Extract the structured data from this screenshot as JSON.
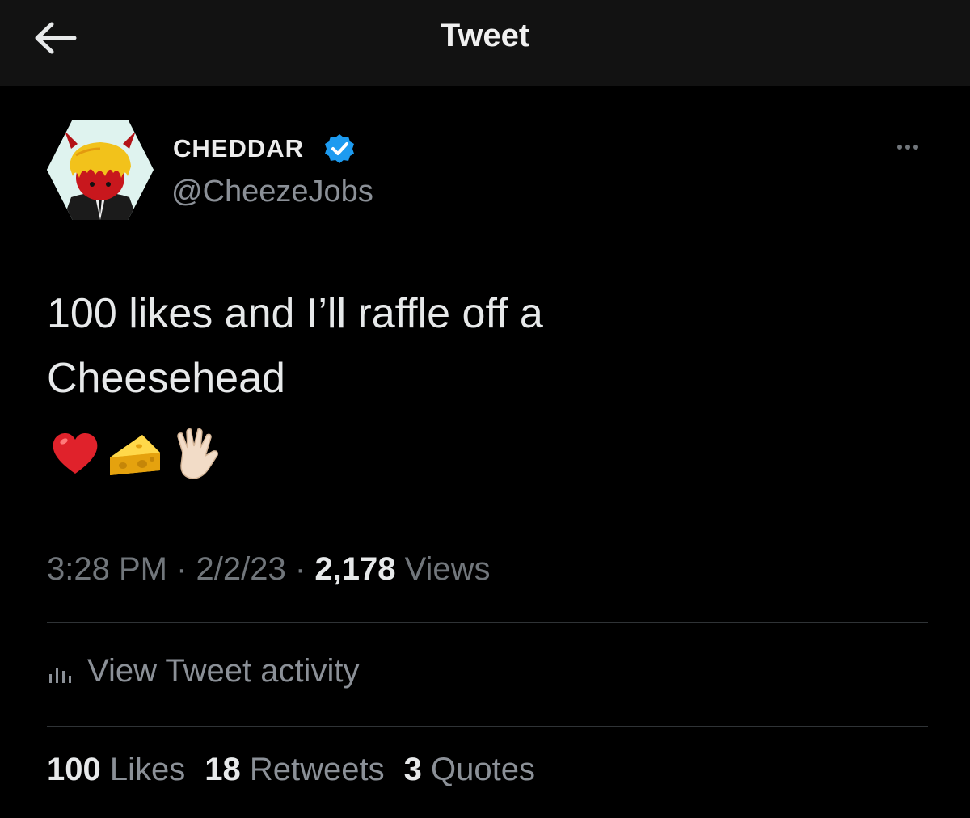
{
  "header": {
    "title": "Tweet",
    "back_icon": "back-arrow-icon"
  },
  "author": {
    "name": "CHEDDAR",
    "handle": "@CheezeJobs",
    "verified": true,
    "verified_color": "#1d9bf0",
    "avatar_icon": "cheese-devil-avatar"
  },
  "tweet": {
    "lines": [
      "100 likes and I’ll raffle off a",
      "Cheesehead"
    ],
    "emojis": [
      "heart-emoji",
      "cheese-emoji",
      "vulcan-salute-emoji"
    ]
  },
  "meta": {
    "time": "3:28 PM",
    "separator": "·",
    "date": "2/2/23",
    "views_count": "2,178",
    "views_label": "Views"
  },
  "activity": {
    "label": "View Tweet activity",
    "icon": "bar-chart-icon"
  },
  "stats": [
    {
      "count": "100",
      "label": "Likes"
    },
    {
      "count": "18",
      "label": "Retweets"
    },
    {
      "count": "3",
      "label": "Quotes"
    }
  ],
  "colors": {
    "background": "#000000",
    "topbar": "#121212",
    "text": "#e7e9ea",
    "muted": "#71767b",
    "divider": "#2f3336"
  }
}
